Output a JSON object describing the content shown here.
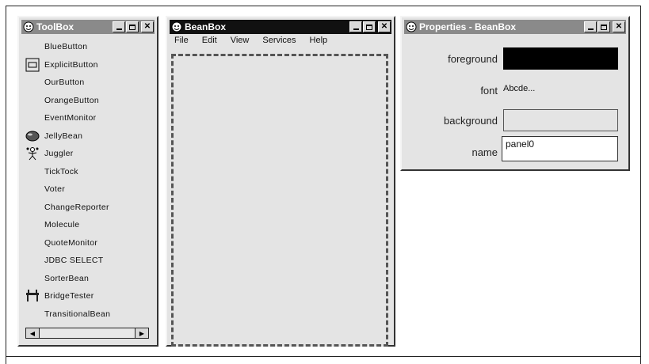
{
  "toolbox": {
    "title": "ToolBox",
    "items": [
      {
        "label": "BlueButton",
        "icon": ""
      },
      {
        "label": "ExplicitButton",
        "icon": "button-icon"
      },
      {
        "label": "OurButton",
        "icon": ""
      },
      {
        "label": "OrangeButton",
        "icon": ""
      },
      {
        "label": "EventMonitor",
        "icon": ""
      },
      {
        "label": "JellyBean",
        "icon": "jellybean-icon"
      },
      {
        "label": "Juggler",
        "icon": "juggler-icon"
      },
      {
        "label": "TickTock",
        "icon": ""
      },
      {
        "label": "Voter",
        "icon": ""
      },
      {
        "label": "ChangeReporter",
        "icon": ""
      },
      {
        "label": "Molecule",
        "icon": ""
      },
      {
        "label": "QuoteMonitor",
        "icon": ""
      },
      {
        "label": "JDBC SELECT",
        "icon": ""
      },
      {
        "label": "SorterBean",
        "icon": ""
      },
      {
        "label": "BridgeTester",
        "icon": "bridge-icon"
      },
      {
        "label": "TransitionalBean",
        "icon": ""
      }
    ]
  },
  "beanbox": {
    "title": "BeanBox",
    "menus": [
      "File",
      "Edit",
      "View",
      "Services",
      "Help"
    ]
  },
  "properties": {
    "title": "Properties - BeanBox",
    "foreground_label": "foreground",
    "foreground_color": "#000000",
    "font_label": "font",
    "font_value": "Abcde...",
    "background_label": "background",
    "background_color": "#e4e4e4",
    "name_label": "name",
    "name_value": "panel0"
  },
  "window_buttons": {
    "minimize": "minimize-icon",
    "maximize": "maximize-icon",
    "close": "close-icon"
  }
}
